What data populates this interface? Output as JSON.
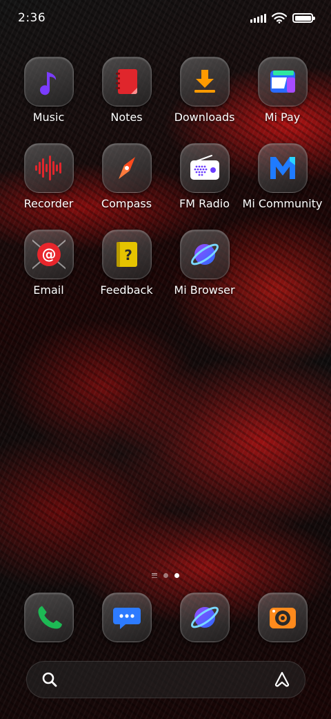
{
  "status_bar": {
    "time": "2:36",
    "signal_icon": "cellular-signal-icon",
    "wifi_icon": "wifi-icon",
    "battery_icon": "battery-icon",
    "battery_level": 1.0
  },
  "apps": [
    {
      "label": "Music",
      "icon": "music-note-icon",
      "color": "#7b3cff"
    },
    {
      "label": "Notes",
      "icon": "notepad-icon",
      "color": "#e0262c"
    },
    {
      "label": "Downloads",
      "icon": "download-arrow-icon",
      "color": "#ff9a00"
    },
    {
      "label": "Mi Pay",
      "icon": "wallet-card-icon",
      "color": "#2a6bff"
    },
    {
      "label": "Recorder",
      "icon": "waveform-icon",
      "color": "#e0262c"
    },
    {
      "label": "Compass",
      "icon": "compass-needle-icon",
      "color": "#ff4a1c"
    },
    {
      "label": "FM Radio",
      "icon": "radio-icon",
      "color": "#6b3cff"
    },
    {
      "label": "Mi Community",
      "icon": "m-logo-icon",
      "color": "#1f7bff"
    },
    {
      "label": "Email",
      "icon": "at-sign-icon",
      "color": "#e8262c"
    },
    {
      "label": "Feedback",
      "icon": "question-book-icon",
      "color": "#e6c400"
    },
    {
      "label": "Mi Browser",
      "icon": "planet-icon",
      "color": "#3d7bff"
    }
  ],
  "page_indicator": {
    "pages": 2,
    "active_page": 2,
    "menu_icon": "app-drawer-lines-icon"
  },
  "dock": [
    {
      "name": "phone",
      "icon": "phone-handset-icon",
      "color": "#1db954"
    },
    {
      "name": "messages",
      "icon": "chat-bubble-icon",
      "color": "#2d7bff"
    },
    {
      "name": "browser",
      "icon": "planet-icon",
      "color": "#3d7bff"
    },
    {
      "name": "camera",
      "icon": "camera-icon",
      "color": "#ff8a1c"
    }
  ],
  "search": {
    "placeholder": "",
    "search_icon": "search-icon",
    "assistant_icon": "assistant-a-icon"
  }
}
